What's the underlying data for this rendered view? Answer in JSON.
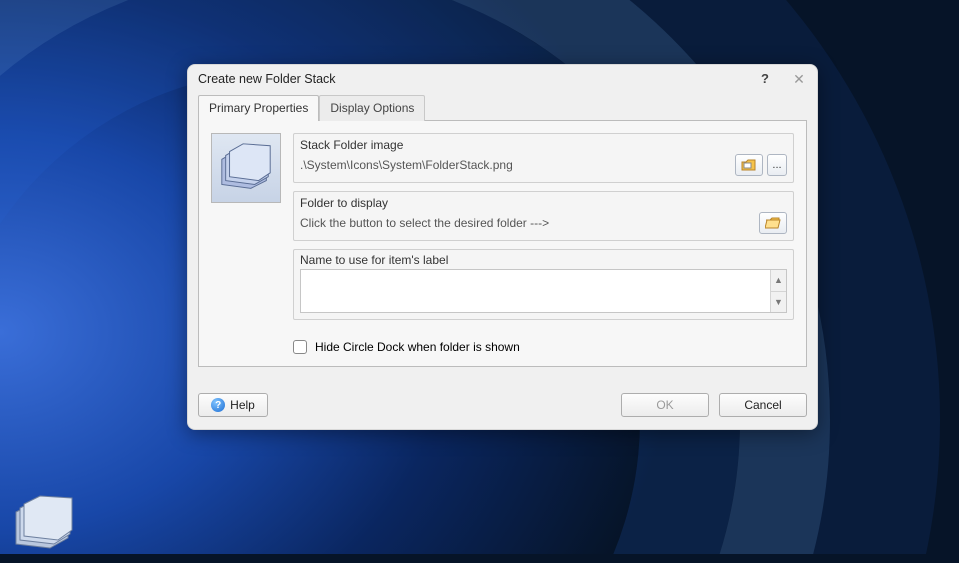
{
  "dialog": {
    "title": "Create new Folder Stack",
    "help_glyph": "?",
    "close_glyph": "✕"
  },
  "tabs": {
    "primary": "Primary Properties",
    "display": "Display Options"
  },
  "fields": {
    "stack_image": {
      "label": "Stack Folder image",
      "value": ".\\System\\Icons\\System\\FolderStack.png",
      "ellipsis": "..."
    },
    "folder_display": {
      "label": "Folder to display",
      "value": "Click the button to select the desired folder --->"
    },
    "name": {
      "label": "Name to use for item's label",
      "value": ""
    }
  },
  "checkbox": {
    "hide_dock": "Hide Circle Dock when folder is shown"
  },
  "buttons": {
    "help": "Help",
    "ok": "OK",
    "cancel": "Cancel"
  }
}
